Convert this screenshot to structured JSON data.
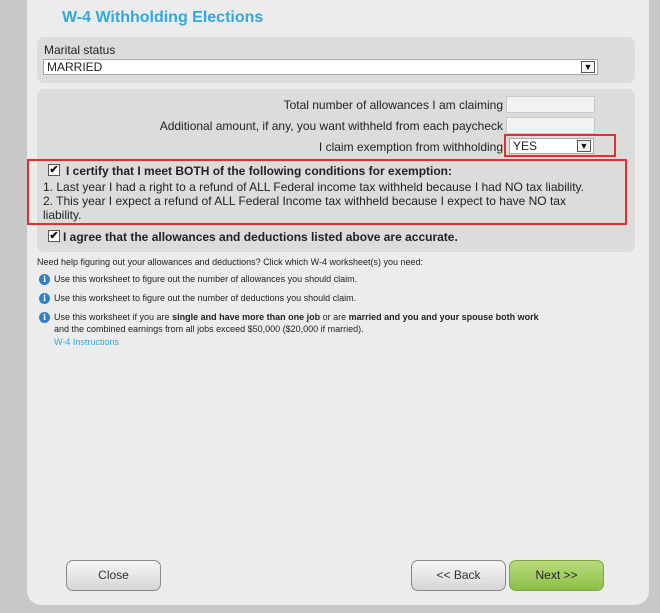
{
  "title": "W-4 Withholding Elections",
  "marital": {
    "label": "Marital status",
    "value": "MARRIED"
  },
  "allowances": {
    "total_label": "Total number of allowances I am claiming",
    "additional_label": "Additional amount, if any, you want withheld from each paycheck",
    "exempt_label": "I claim exemption from withholding",
    "exempt_value": "YES"
  },
  "certify": {
    "label": "I certify that I meet BOTH of the following conditions for exemption:",
    "line1": "1. Last year I had a right to a refund of ALL Federal income tax withheld because I had NO tax liability.",
    "line2a": "2. This year I expect a refund of ALL Federal Income tax withheld because I expect to have NO tax",
    "line2b": "liability."
  },
  "agree": {
    "label": "I agree that the allowances and deductions listed above are accurate."
  },
  "help": {
    "intro": "Need help figuring out your allowances and deductions? Click which W-4 worksheet(s) you need:",
    "item1": "Use this worksheet to figure out the number of allowances you should claim.",
    "item2": "Use this worksheet to figure out the number of deductions you should claim.",
    "item3_a": "Use this worksheet if you are ",
    "item3_b": "single and have more than one job",
    "item3_c": " or are ",
    "item3_d": "married and you and your spouse both work",
    "item3_e": "and the combined earnings from all jobs exceed $50,000 ($20,000 if married).",
    "link": "W-4 Instructions"
  },
  "buttons": {
    "close": "Close",
    "back": "<< Back",
    "next": "Next >>"
  },
  "checkmark": "✔",
  "icons": {
    "dropdown": "chevron-down-icon",
    "info": "info-icon",
    "check": "checkmark-icon"
  },
  "colors": {
    "title": "#2fa9e0",
    "highlight": "#e03131",
    "next_button": "#9bcb5a",
    "info_icon": "#2f7fd1"
  }
}
